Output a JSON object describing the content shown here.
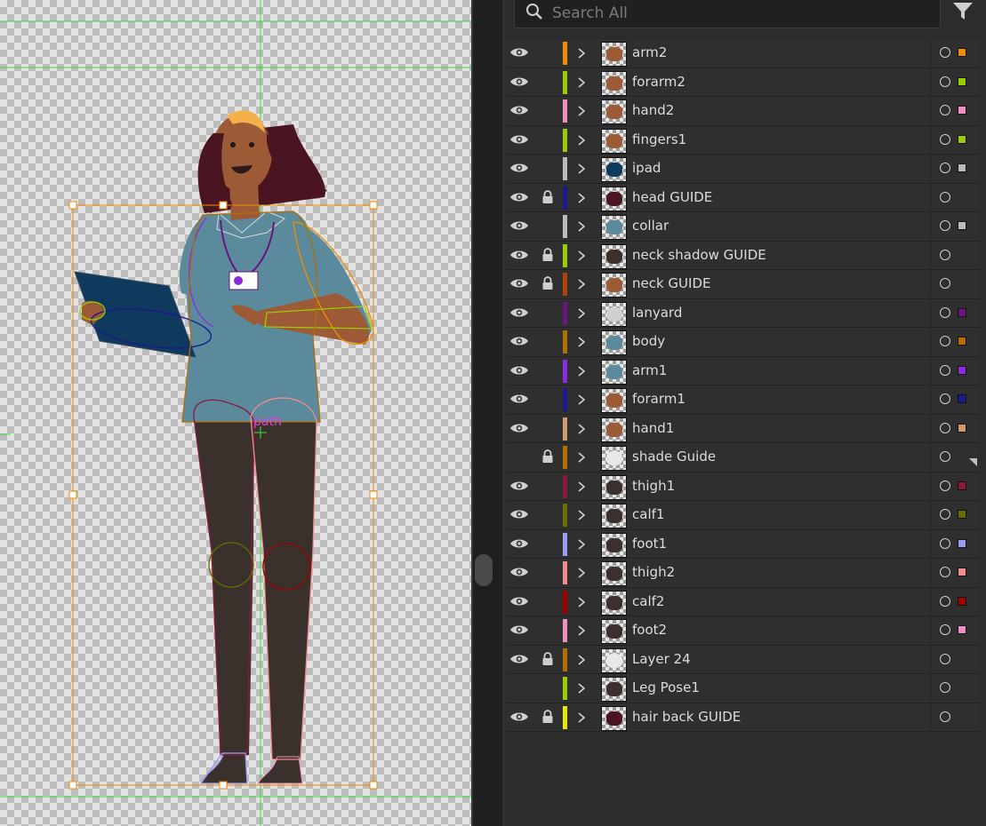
{
  "canvas": {
    "path_label": "path"
  },
  "panel": {
    "search_placeholder": "Search All",
    "layers": [
      {
        "name": "arm2",
        "visible": true,
        "locked": false,
        "color": "#f08c00",
        "selected": true
      },
      {
        "name": "forarm2",
        "visible": true,
        "locked": false,
        "color": "#9acd00",
        "selected": true
      },
      {
        "name": "hand2",
        "visible": true,
        "locked": false,
        "color": "#ef8ec0",
        "selected": true
      },
      {
        "name": "fingers1",
        "visible": true,
        "locked": false,
        "color": "#9acd00",
        "selected": true
      },
      {
        "name": "ipad",
        "visible": true,
        "locked": false,
        "color": "#bcbcbc",
        "selected": true
      },
      {
        "name": "head GUIDE",
        "visible": true,
        "locked": true,
        "color": "#1a1a8c",
        "selected": false
      },
      {
        "name": "collar",
        "visible": true,
        "locked": false,
        "color": "#bcbcbc",
        "selected": true
      },
      {
        "name": "neck shadow GUIDE",
        "visible": true,
        "locked": true,
        "color": "#9acd00",
        "selected": false
      },
      {
        "name": "neck GUIDE",
        "visible": true,
        "locked": true,
        "color": "#b5400a",
        "selected": false
      },
      {
        "name": "lanyard",
        "visible": true,
        "locked": false,
        "color": "#6a1680",
        "selected": true
      },
      {
        "name": "body",
        "visible": true,
        "locked": false,
        "color": "#b06f00",
        "selected": true
      },
      {
        "name": "arm1",
        "visible": true,
        "locked": false,
        "color": "#8a2be2",
        "selected": true
      },
      {
        "name": "forarm1",
        "visible": true,
        "locked": false,
        "color": "#1a1a8c",
        "selected": true
      },
      {
        "name": "hand1",
        "visible": true,
        "locked": false,
        "color": "#d29a6a",
        "selected": true
      },
      {
        "name": "shade Guide",
        "visible": false,
        "locked": true,
        "color": "#b06f00",
        "selected": false
      },
      {
        "name": "thigh1",
        "visible": true,
        "locked": false,
        "color": "#8b1a3a",
        "selected": true
      },
      {
        "name": "calf1",
        "visible": true,
        "locked": false,
        "color": "#6b6b00",
        "selected": true
      },
      {
        "name": "foot1",
        "visible": true,
        "locked": false,
        "color": "#9c9cf2",
        "selected": true
      },
      {
        "name": "thigh2",
        "visible": true,
        "locked": false,
        "color": "#f08c8c",
        "selected": true
      },
      {
        "name": "calf2",
        "visible": true,
        "locked": false,
        "color": "#a00000",
        "selected": true
      },
      {
        "name": "foot2",
        "visible": true,
        "locked": false,
        "color": "#ef8ec0",
        "selected": true
      },
      {
        "name": "Layer 24",
        "visible": true,
        "locked": true,
        "color": "#b06f00",
        "selected": false
      },
      {
        "name": "Leg Pose1",
        "visible": false,
        "locked": false,
        "color": "#9acd00",
        "selected": false
      },
      {
        "name": "hair back GUIDE",
        "visible": true,
        "locked": true,
        "color": "#e6e600",
        "selected": false
      }
    ]
  }
}
